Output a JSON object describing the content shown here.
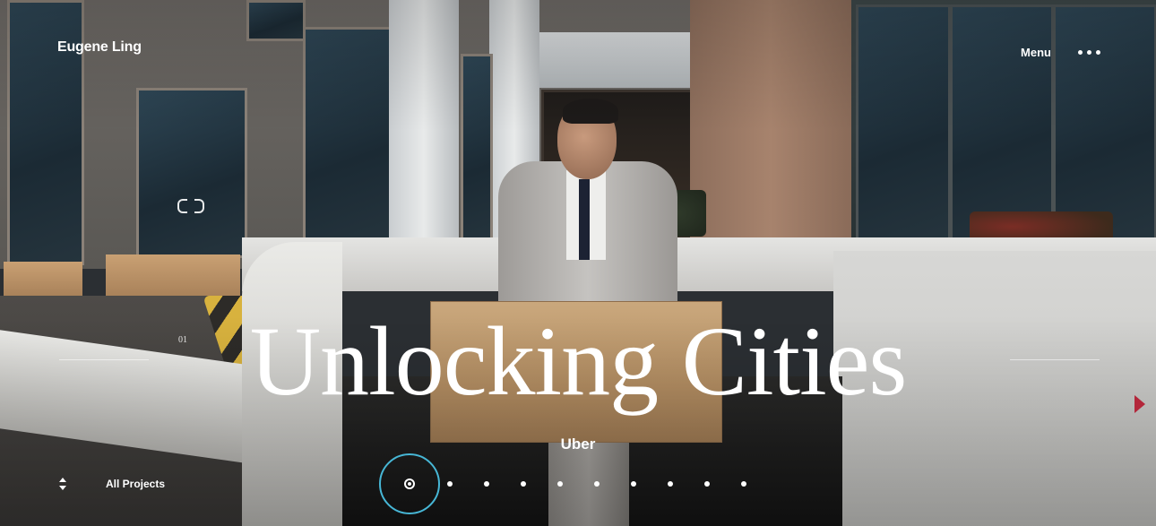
{
  "header": {
    "brand": "Eugene Ling",
    "menu_label": "Menu",
    "menu_icon": "more-dots-icon"
  },
  "hero": {
    "index": "01",
    "title": "Unlocking Cities",
    "client": "Uber"
  },
  "footer": {
    "all_projects_label": "All Projects",
    "all_projects_icon": "up-down-icon"
  },
  "pagination": {
    "active_index": 1,
    "total": 10,
    "accent_color": "#47b7d6"
  }
}
